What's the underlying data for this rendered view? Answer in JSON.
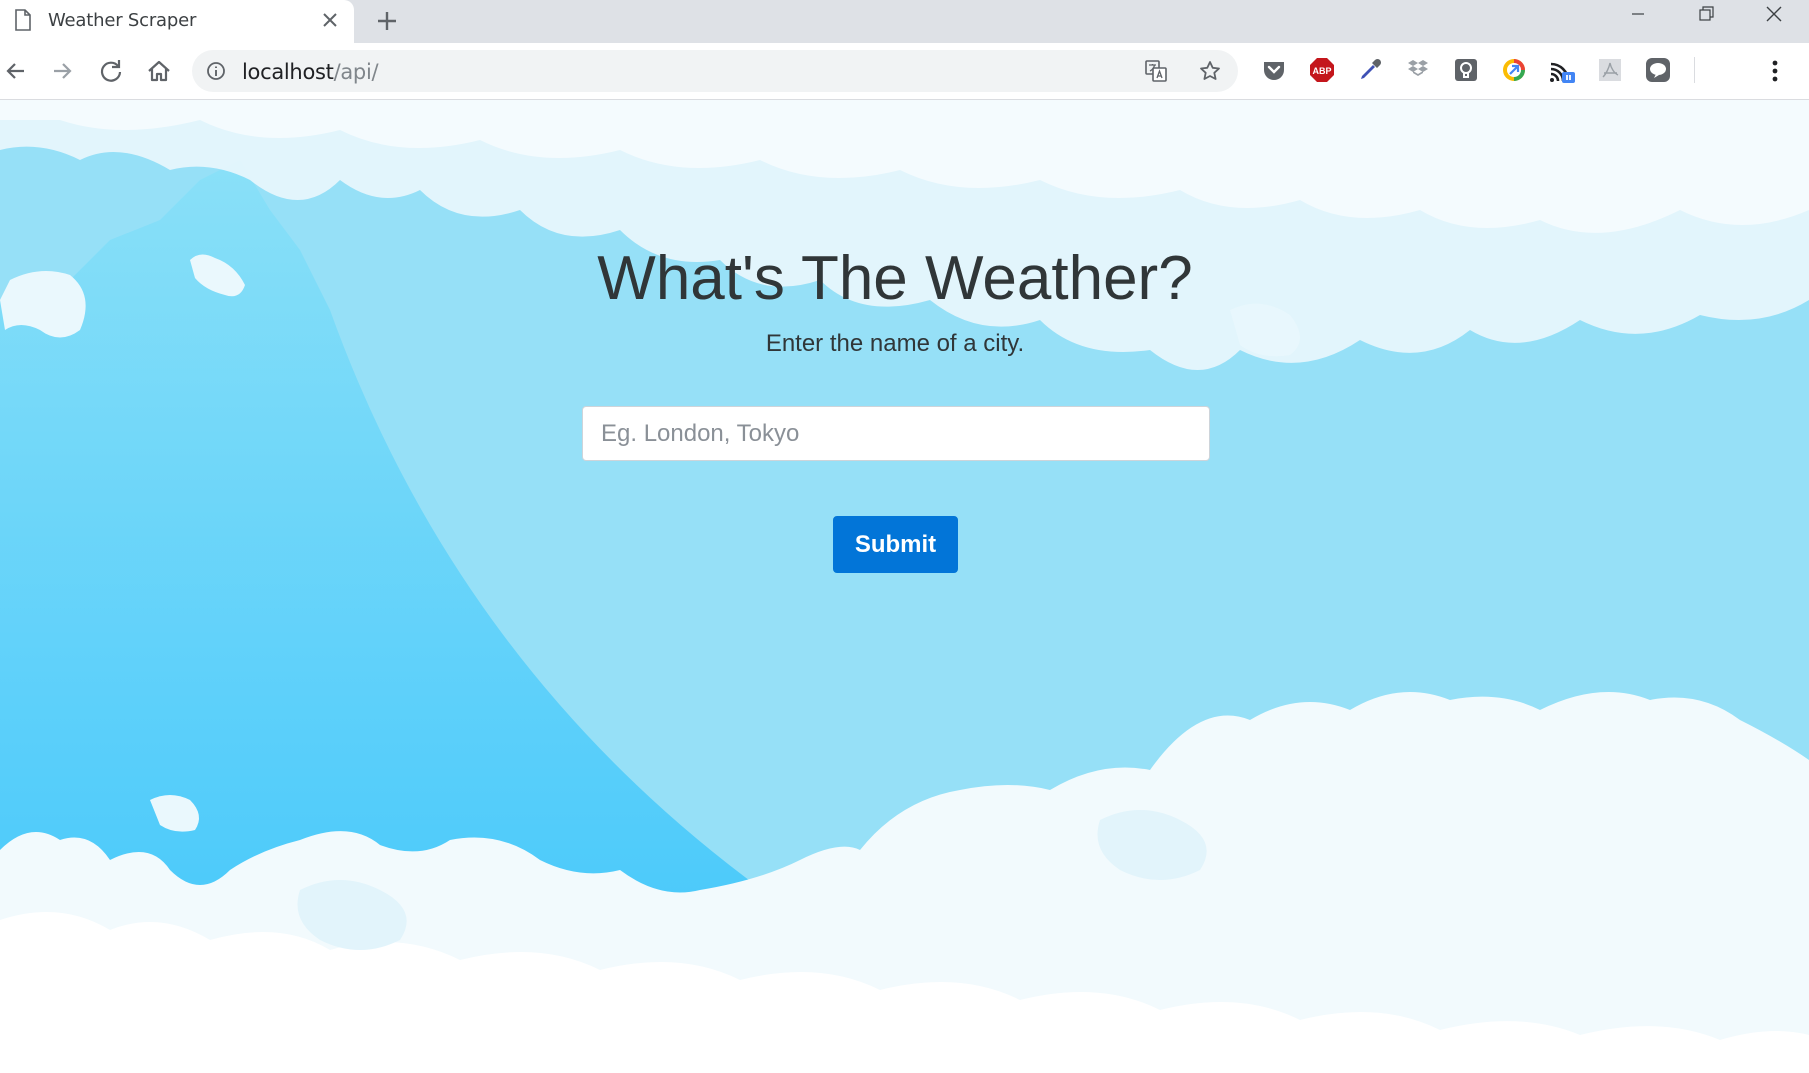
{
  "browser": {
    "tab": {
      "title": "Weather Scraper",
      "icon": "page-icon"
    },
    "address_bar": {
      "host": "localhost",
      "path": "/api/"
    },
    "extensions": [
      "pocket-icon",
      "adblock-plus-icon",
      "eyedropper-icon",
      "dropbox-icon",
      "lightbulb-icon",
      "chrome-remote-icon",
      "cast-icon",
      "pdf-icon",
      "line-icon"
    ],
    "adblock_label": "ABP",
    "colors": {
      "tab_strip": "#dee1e6",
      "omnibox": "#f1f3f4",
      "adblock": "#c4161c"
    }
  },
  "page": {
    "heading": "What's The Weather?",
    "subheading": "Enter the name of a city.",
    "search": {
      "placeholder": "Eg. London, Tokyo",
      "value": ""
    },
    "submit_label": "Submit",
    "colors": {
      "button": "#0275d8",
      "text": "#303638",
      "sky": "#5fd0fa"
    }
  }
}
